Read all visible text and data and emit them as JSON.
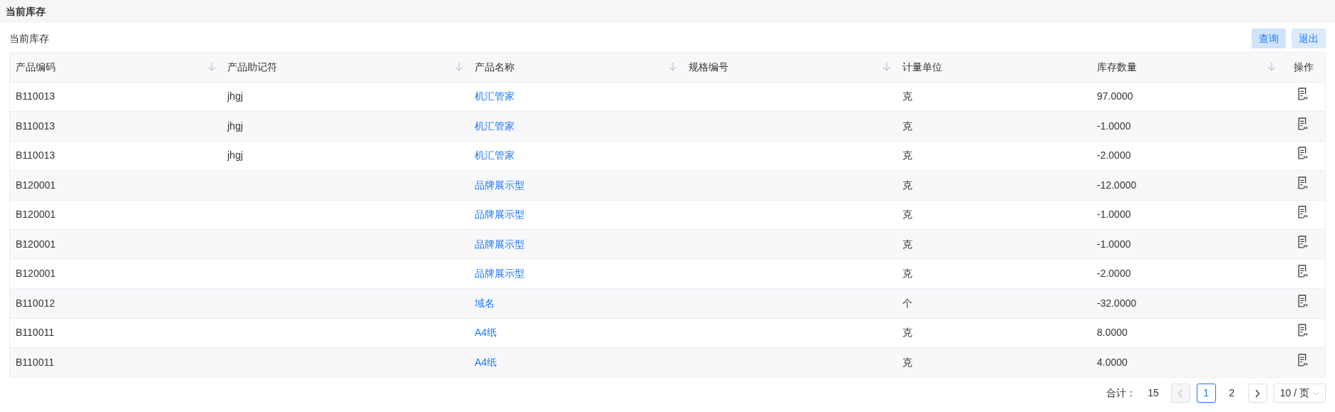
{
  "header": {
    "title": "当前库存"
  },
  "toolbar": {
    "title": "当前库存",
    "buttons": [
      "查询",
      "退出"
    ]
  },
  "table": {
    "columns": [
      {
        "label": "产品编码",
        "sortable": true
      },
      {
        "label": "产品助记符",
        "sortable": true
      },
      {
        "label": "产品名称",
        "sortable": true
      },
      {
        "label": "规格编号",
        "sortable": true
      },
      {
        "label": "计量单位",
        "sortable": false
      },
      {
        "label": "库存数量",
        "sortable": true
      },
      {
        "label": "操作",
        "sortable": false
      }
    ],
    "rows": [
      [
        "B110013",
        "jhgj",
        "机汇管家",
        "",
        "克",
        "97.0000"
      ],
      [
        "B110013",
        "jhgj",
        "机汇管家",
        "",
        "克",
        "-1.0000"
      ],
      [
        "B110013",
        "jhgj",
        "机汇管家",
        "",
        "克",
        "-2.0000"
      ],
      [
        "B120001",
        "",
        "品牌展示型",
        "",
        "克",
        "-12.0000"
      ],
      [
        "B120001",
        "",
        "品牌展示型",
        "",
        "克",
        "-1.0000"
      ],
      [
        "B120001",
        "",
        "品牌展示型",
        "",
        "克",
        "-1.0000"
      ],
      [
        "B120001",
        "",
        "品牌展示型",
        "",
        "克",
        "-2.0000"
      ],
      [
        "B110012",
        "",
        "域名",
        "",
        "个",
        "-32.0000"
      ],
      [
        "B110011",
        "",
        "A4纸",
        "",
        "克",
        "8.0000"
      ],
      [
        "B110011",
        "",
        "A4纸",
        "",
        "克",
        "4.0000"
      ]
    ]
  },
  "pagination": {
    "total_label": "合计：",
    "total": "15",
    "prev_disabled": true,
    "next_disabled": false,
    "pages": [
      {
        "label": "1",
        "selected": true
      },
      {
        "label": "2",
        "selected": false
      }
    ],
    "page_size": "10 / 页"
  }
}
